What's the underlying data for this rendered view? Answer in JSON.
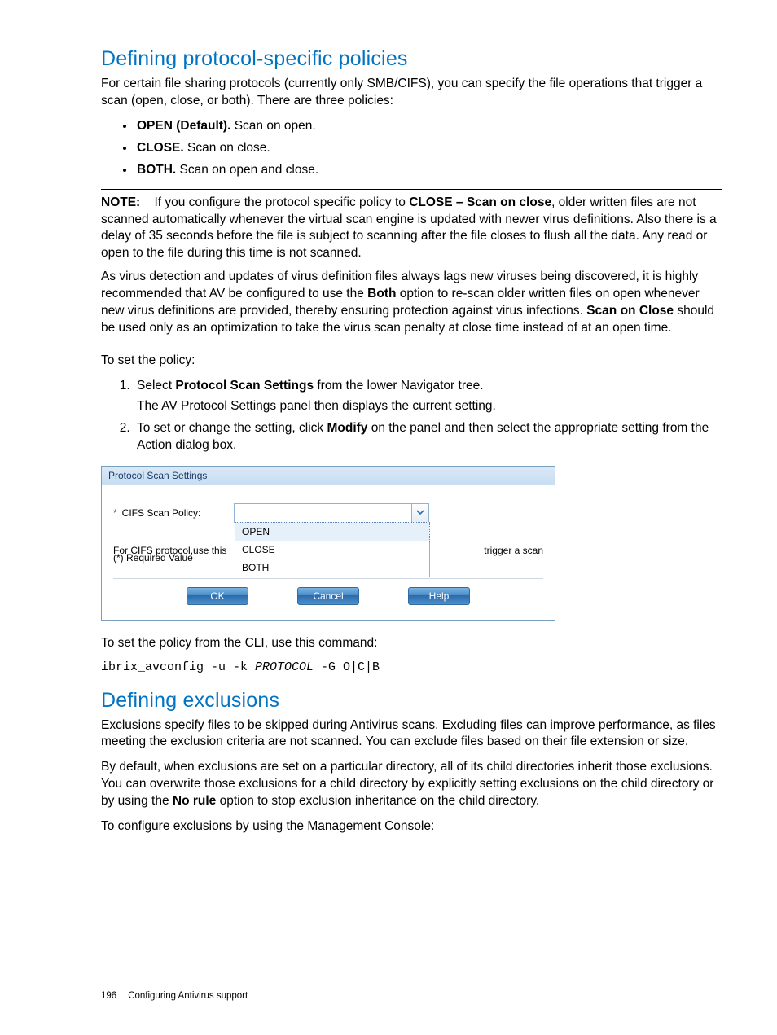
{
  "section1": {
    "heading": "Defining protocol-specific policies",
    "intro": "For certain file sharing protocols (currently only SMB/CIFS), you can specify the file operations that trigger a scan (open, close, or both). There are three policies:",
    "bullets": [
      {
        "label": "OPEN (Default).",
        "text": " Scan on open."
      },
      {
        "label": "CLOSE.",
        "text": " Scan on close."
      },
      {
        "label": "BOTH.",
        "text": " Scan on open and close."
      }
    ],
    "note": {
      "label": "NOTE:",
      "p1_a": "If you configure the protocol specific policy to ",
      "p1_bold": "CLOSE – Scan on close",
      "p1_b": ", older written files are not scanned automatically whenever the virtual scan engine is updated with newer virus definitions. Also there is a delay of 35 seconds before the file is subject to scanning after the file closes to flush all the data. Any read or open to the file during this time is not scanned.",
      "p2_a": "As virus detection and updates of virus definition files always lags new viruses being discovered, it is highly recommended that AV be configured to use the ",
      "p2_bold1": "Both",
      "p2_b": " option to re-scan older written files on open whenever new virus definitions are provided, thereby ensuring protection against virus infections. ",
      "p2_bold2": "Scan on Close",
      "p2_c": " should be used only as an optimization to take the virus scan penalty at close time instead of at an open time."
    },
    "to_set": "To set the policy:",
    "steps": [
      {
        "a": "Select ",
        "bold": "Protocol Scan Settings",
        "b": " from the lower Navigator tree.",
        "sub": "The AV Protocol Settings panel then displays the current setting."
      },
      {
        "a": "To set or change the setting, click ",
        "bold": "Modify",
        "b": " on the panel and then select the appropriate setting from the Action dialog box.",
        "sub": ""
      }
    ],
    "cli_intro": "To set the policy from the CLI, use this command:",
    "cli_cmd_a": "ibrix_avconfig -u -k ",
    "cli_cmd_italic": "PROTOCOL",
    "cli_cmd_b": " -G O|C|B"
  },
  "dialog": {
    "title": "Protocol Scan Settings",
    "field_label": "CIFS Scan Policy:",
    "options": [
      "OPEN",
      "CLOSE",
      "BOTH"
    ],
    "behind_left": "For CIFS protocol,use this",
    "behind_right": "trigger a scan",
    "required": "(*) Required Value",
    "buttons": {
      "ok": "OK",
      "cancel": "Cancel",
      "help": "Help"
    }
  },
  "section2": {
    "heading": "Defining exclusions",
    "p1": "Exclusions specify files to be skipped during Antivirus scans. Excluding files can improve performance, as files meeting the exclusion criteria are not scanned. You can exclude files based on their file extension or size.",
    "p2_a": "By default, when exclusions are set on a particular directory, all of its child directories inherit those exclusions. You can overwrite those exclusions for a child directory by explicitly setting exclusions on the child directory or by using the ",
    "p2_bold": "No rule",
    "p2_b": " option to stop exclusion inheritance on the child directory.",
    "p3": "To configure exclusions by using the Management Console:"
  },
  "footer": {
    "page": "196",
    "chapter": "Configuring Antivirus support"
  }
}
